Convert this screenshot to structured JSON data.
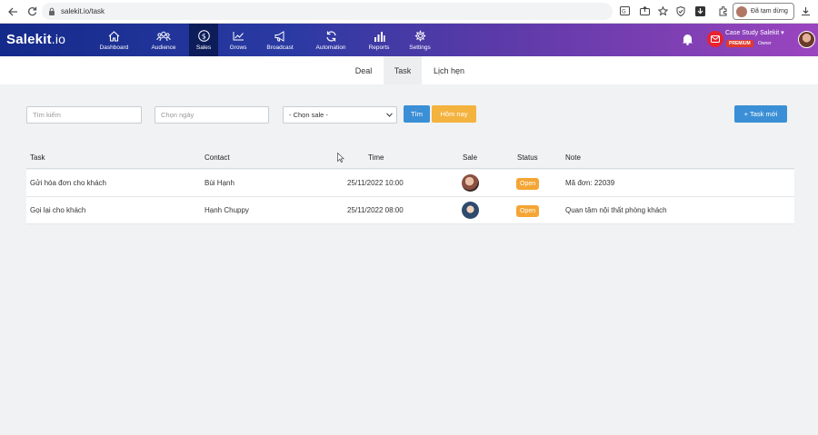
{
  "browser": {
    "url": "salekit.io/task",
    "paused_label": "Đã tạm dừng"
  },
  "app": {
    "logo_main": "Salekit",
    "logo_suffix": ".io",
    "nav": [
      {
        "label": "Dashboard",
        "icon": "home-icon"
      },
      {
        "label": "Audience",
        "icon": "users-icon"
      },
      {
        "label": "Sales",
        "icon": "dollar-icon",
        "active": true
      },
      {
        "label": "Grows",
        "icon": "chart-line-icon"
      },
      {
        "label": "Broadcast",
        "icon": "megaphone-icon"
      },
      {
        "label": "Automation",
        "icon": "refresh-icon"
      },
      {
        "label": "Reports",
        "icon": "bar-chart-icon"
      },
      {
        "label": "Settings",
        "icon": "gear-icon"
      }
    ],
    "account": {
      "name": "Case Study Salekit",
      "badge": "PREMIUM",
      "role": "Owner"
    }
  },
  "subtabs": [
    {
      "label": "Deal",
      "active": false
    },
    {
      "label": "Task",
      "active": true
    },
    {
      "label": "Lịch hẹn",
      "active": false
    }
  ],
  "filters": {
    "search_placeholder": "Tìm kiếm",
    "date_placeholder": "Chọn ngày",
    "sale_select": "- Chọn sale -",
    "search_button": "Tìm",
    "today_button": "Hôm nay",
    "new_task_button": "+ Task mới"
  },
  "table": {
    "columns": [
      "Task",
      "Contact",
      "Time",
      "Sale",
      "Status",
      "Note"
    ],
    "rows": [
      {
        "task": "Gửi hóa đơn cho khách",
        "contact": "Bùi Hạnh",
        "time": "25/11/2022 10:00",
        "status": "Open",
        "note": "Mã đơn: 22039"
      },
      {
        "task": "Gọi lại cho khách",
        "contact": "Hạnh Chuppy",
        "time": "25/11/2022 08:00",
        "status": "Open",
        "note": "Quan tâm nội thất phòng khách"
      }
    ]
  },
  "colors": {
    "primary_button": "#3b8fd6",
    "today_button": "#f4b23e",
    "status_open": "#f4a534"
  }
}
